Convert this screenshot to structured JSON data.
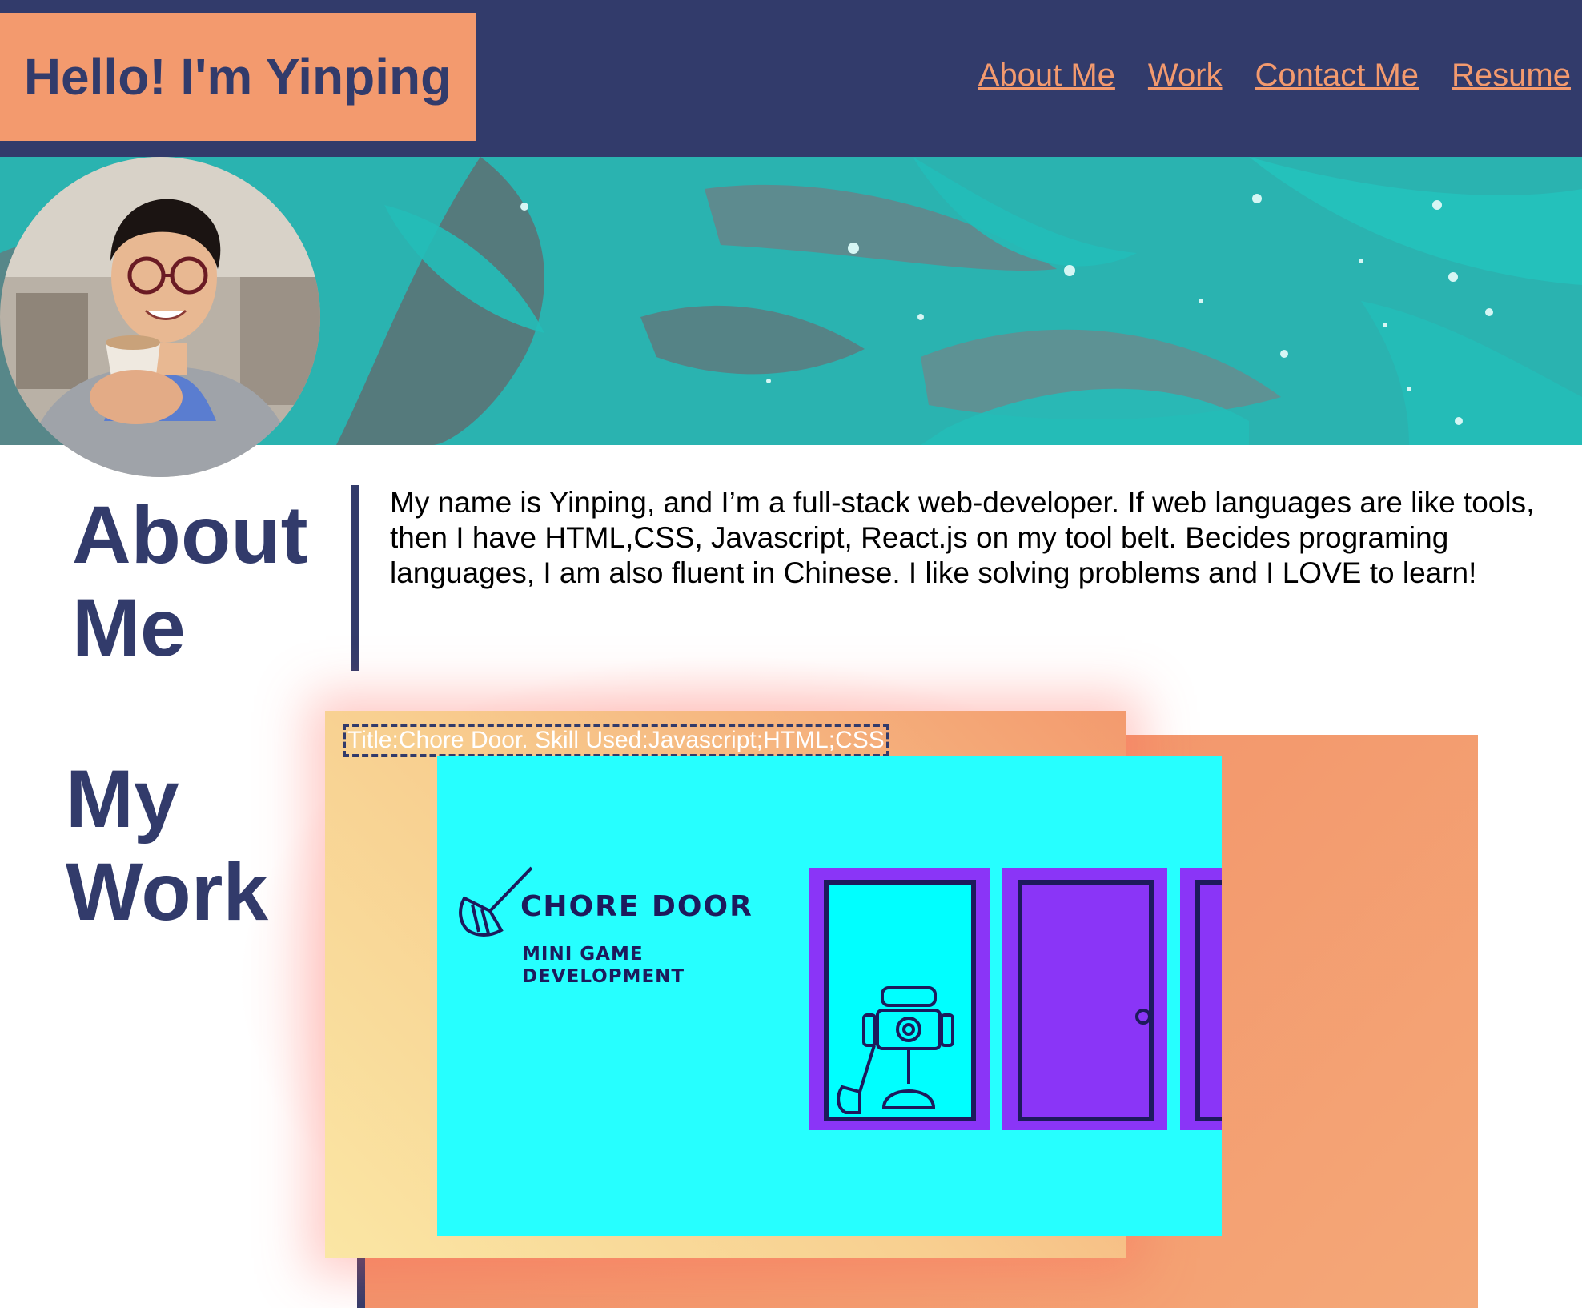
{
  "header": {
    "title": "Hello! I'm Yinping",
    "nav": [
      "About Me",
      "Work",
      "Contact Me",
      "Resume"
    ]
  },
  "about": {
    "heading": "About\nMe",
    "text": "My name is Yinping, and I’m a full-stack web-developer. If web languages are like tools, then I have HTML,CSS, Javascript, React.js on my tool belt. Becides programing languages, I am also fluent in Chinese. I like solving problems and I LOVE to learn!"
  },
  "work": {
    "heading": "My\nWork",
    "project": {
      "caption": "Title:Chore Door. Skill Used:Javascript;HTML;CSS",
      "image_title": "CHORE DOOR",
      "image_subtitle": "MINI GAME\nDEVELOPMENT"
    }
  },
  "colors": {
    "navy": "#323b6b",
    "peach": "#f39a6e",
    "teal": "#2ab3b0",
    "cyan": "#26ffff",
    "purple": "#8a35f7"
  }
}
